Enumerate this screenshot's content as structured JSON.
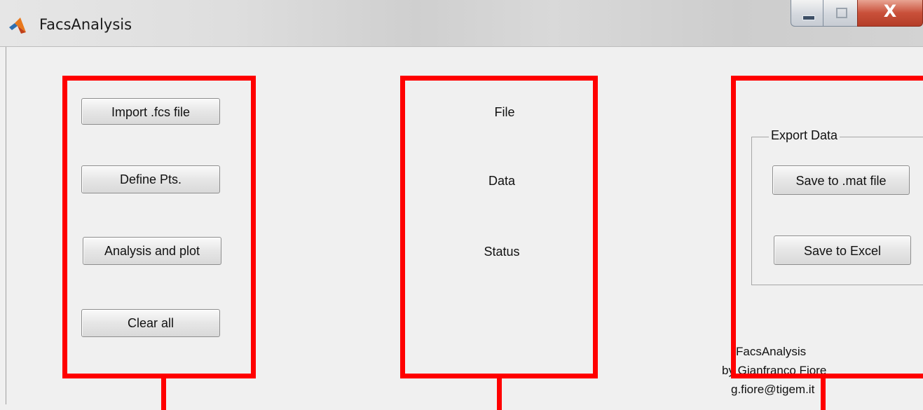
{
  "window": {
    "title": "FacsAnalysis",
    "app_icon": "matlab-icon",
    "controls": {
      "minimize": "minimize-icon",
      "maximize": "maximize-icon",
      "close_glyph": "X"
    }
  },
  "actions_panel": {
    "buttons": [
      {
        "label": "Import .fcs file"
      },
      {
        "label": "Define Pts."
      },
      {
        "label": "Analysis and plot"
      },
      {
        "label": "Clear all"
      }
    ]
  },
  "info_panel": {
    "file_label": "File",
    "data_label": "Data",
    "status_label": "Status"
  },
  "export_panel": {
    "group_title": "Export Data",
    "save_mat_label": "Save to .mat file",
    "save_excel_label": "Save to Excel"
  },
  "credits": {
    "app_name": "FacsAnalysis",
    "author": "by Gianfranco Fiore",
    "email": "g.fiore@tigem.it"
  },
  "annotations": {
    "highlight_color": "#ff0000"
  }
}
